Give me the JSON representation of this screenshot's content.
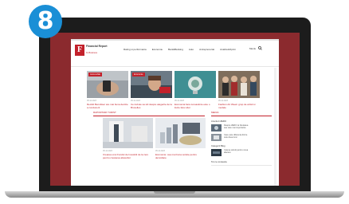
{
  "step": {
    "number": "8"
  },
  "colors": {
    "page_background": "#8b2a2e",
    "brand": "#c3212b",
    "badge": "#1a8fd6"
  },
  "site": {
    "logo_letter": "F",
    "logo_title": "Financial Report",
    "logo_subtitle": "fin.Business",
    "nav": [
      "Rating si performanta",
      "Economie",
      "Bani&Banking",
      "Auto",
      "Antreprenoriat",
      "Analize&Opinii"
    ],
    "header_right": {
      "label": "Meniu",
      "search_icon": "search-icon"
    },
    "hero_articles": [
      {
        "category": "Automobile",
        "caption": "Reckitt Benckiser are mai buna decizie a conducerii",
        "meta": "05.12.2023"
      },
      {
        "category": "Economie",
        "caption": "Ce trebuie sa stii despre alegerile de la Bruxelles",
        "meta": "05.12.2023"
      },
      {
        "category": "",
        "caption": "Economia fara cunoastinte este o iluzie fara viitor",
        "meta": "05.12.2023"
      },
      {
        "category": "",
        "caption": "Fashion Art Week: grup de artisti si modele",
        "meta": "05.12.2023"
      }
    ],
    "featured_title": "RAPORTARI TURIST",
    "featured_articles": [
      {
        "caption": "Crearea unui Fondul de Investitii de la zero pentru cresterea afacerilor",
        "meta": "05.12.2023"
      },
      {
        "caption": "Economie: cea mai buna solutie pentru dezvoltare",
        "meta": "05.12.2023"
      }
    ],
    "sidebar_title": "MEDIA",
    "sidebar_label_1": "Anunturi ZERO",
    "sidebar_items": [
      {
        "text": "Despre ZERO la Noutatea sau cele mai importante"
      },
      {
        "text": "Care este diferenta dintre cele doua lumi"
      },
      {
        "text": "Cateva solutii pentru noua afacere"
      }
    ],
    "sidebar_label_2": "Categorii Blog",
    "sidebar_label_3": "Tot ce conteaza"
  }
}
